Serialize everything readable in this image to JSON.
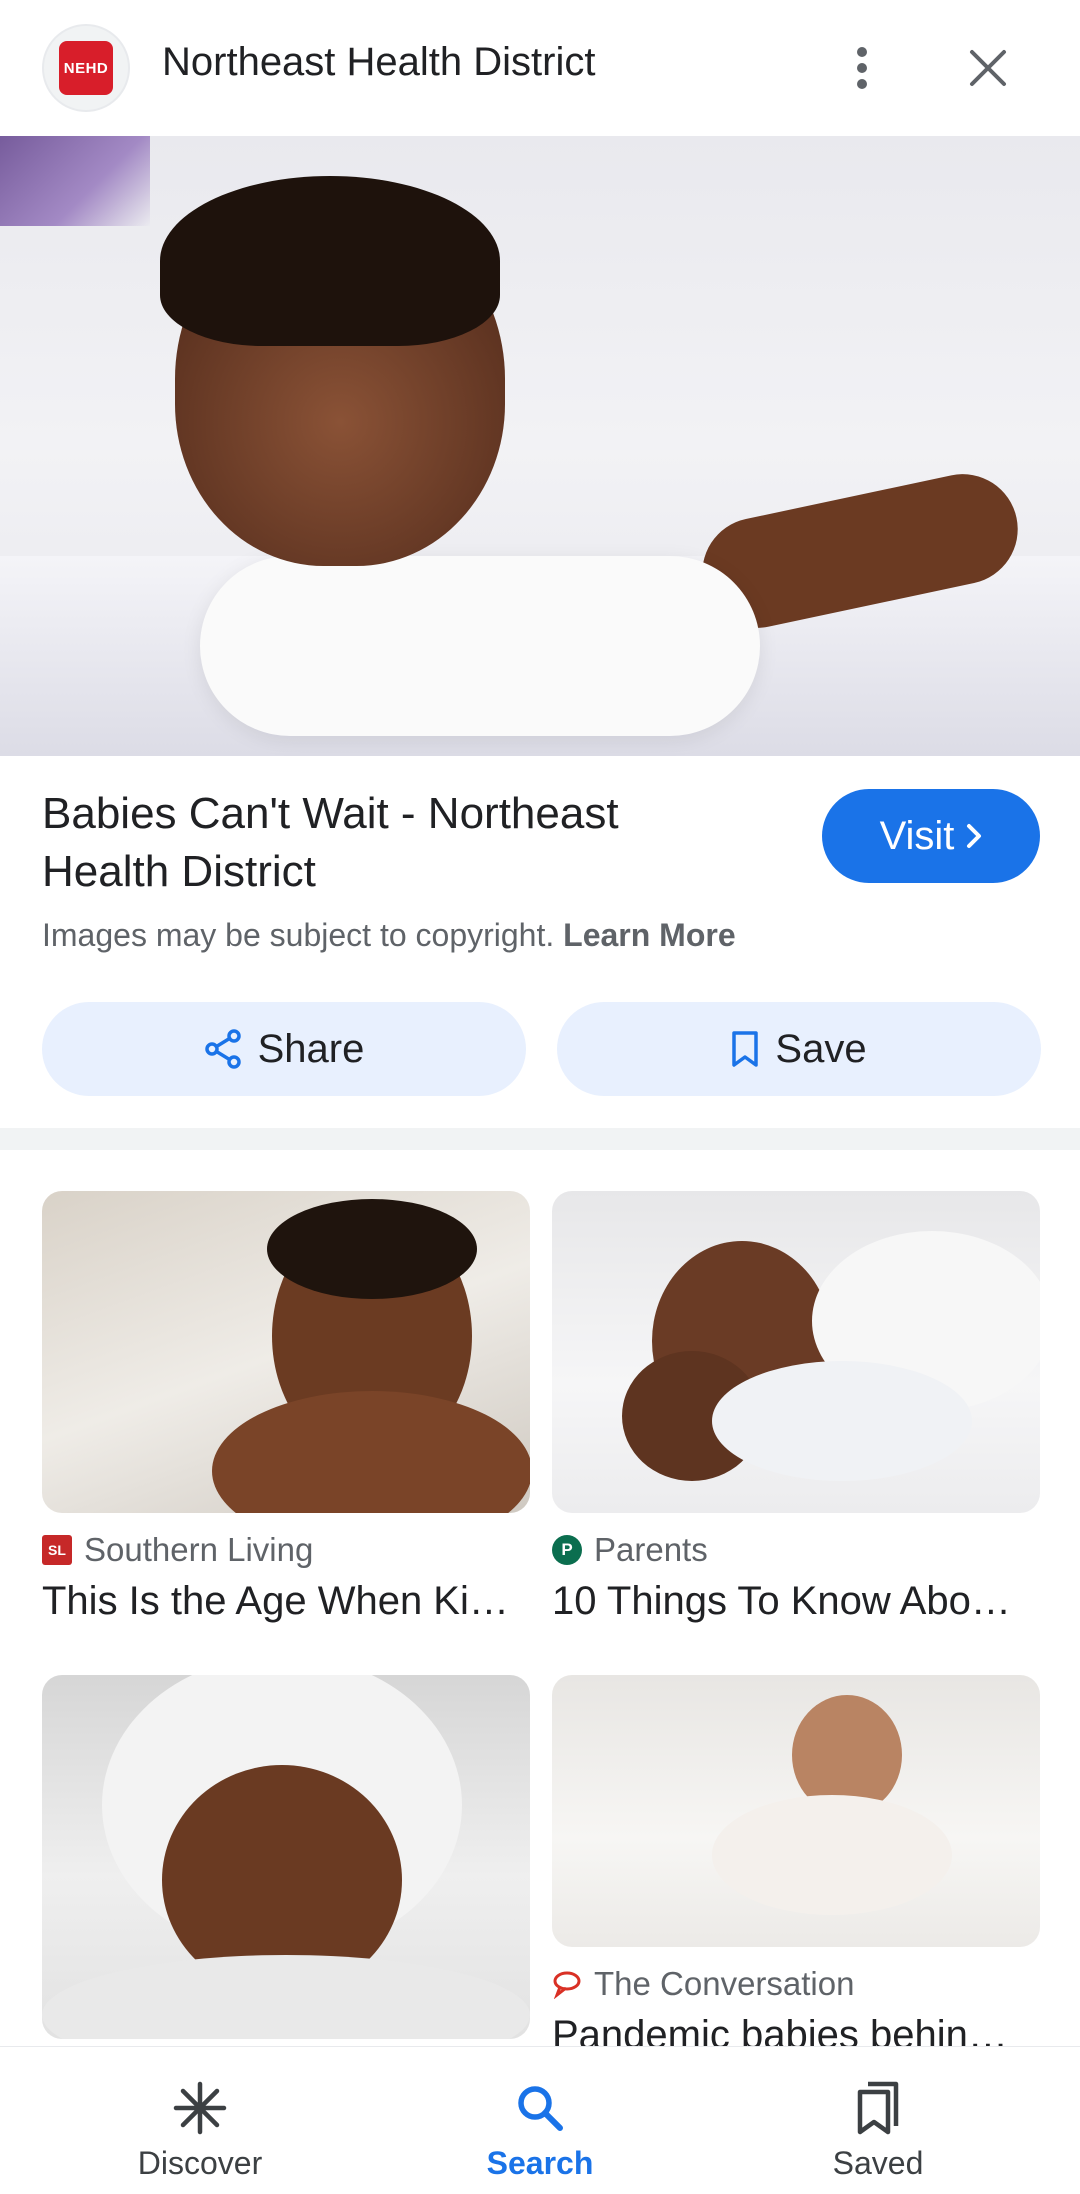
{
  "header": {
    "logo_text": "NEHD",
    "title": "Northeast Health District"
  },
  "result": {
    "title": "Babies Can't Wait - Northeast Health District",
    "visit_label": "Visit",
    "copyright_text": "Images may be subject to copyright.",
    "learn_more_label": "Learn More",
    "share_label": "Share",
    "save_label": "Save"
  },
  "related": [
    {
      "source": "Southern Living",
      "source_icon": "SL",
      "caption": "This Is the Age When Ki…"
    },
    {
      "source": "Parents",
      "source_icon": "P",
      "caption": "10 Things To Know Abo…"
    },
    {
      "source": "",
      "source_icon": "",
      "caption": ""
    },
    {
      "source": "The Conversation",
      "source_icon": "speech-bubble-icon",
      "caption": "Pandemic babies behin…"
    }
  ],
  "bottom_nav": {
    "items": [
      {
        "label": "Discover",
        "icon": "asterisk-icon",
        "active": false
      },
      {
        "label": "Search",
        "icon": "search-icon",
        "active": true
      },
      {
        "label": "Saved",
        "icon": "bookmarks-icon",
        "active": false
      }
    ]
  },
  "colors": {
    "accent": "#1a73e8",
    "action_button_bg": "#e8f0fe",
    "logo_red": "#d81e2a"
  }
}
